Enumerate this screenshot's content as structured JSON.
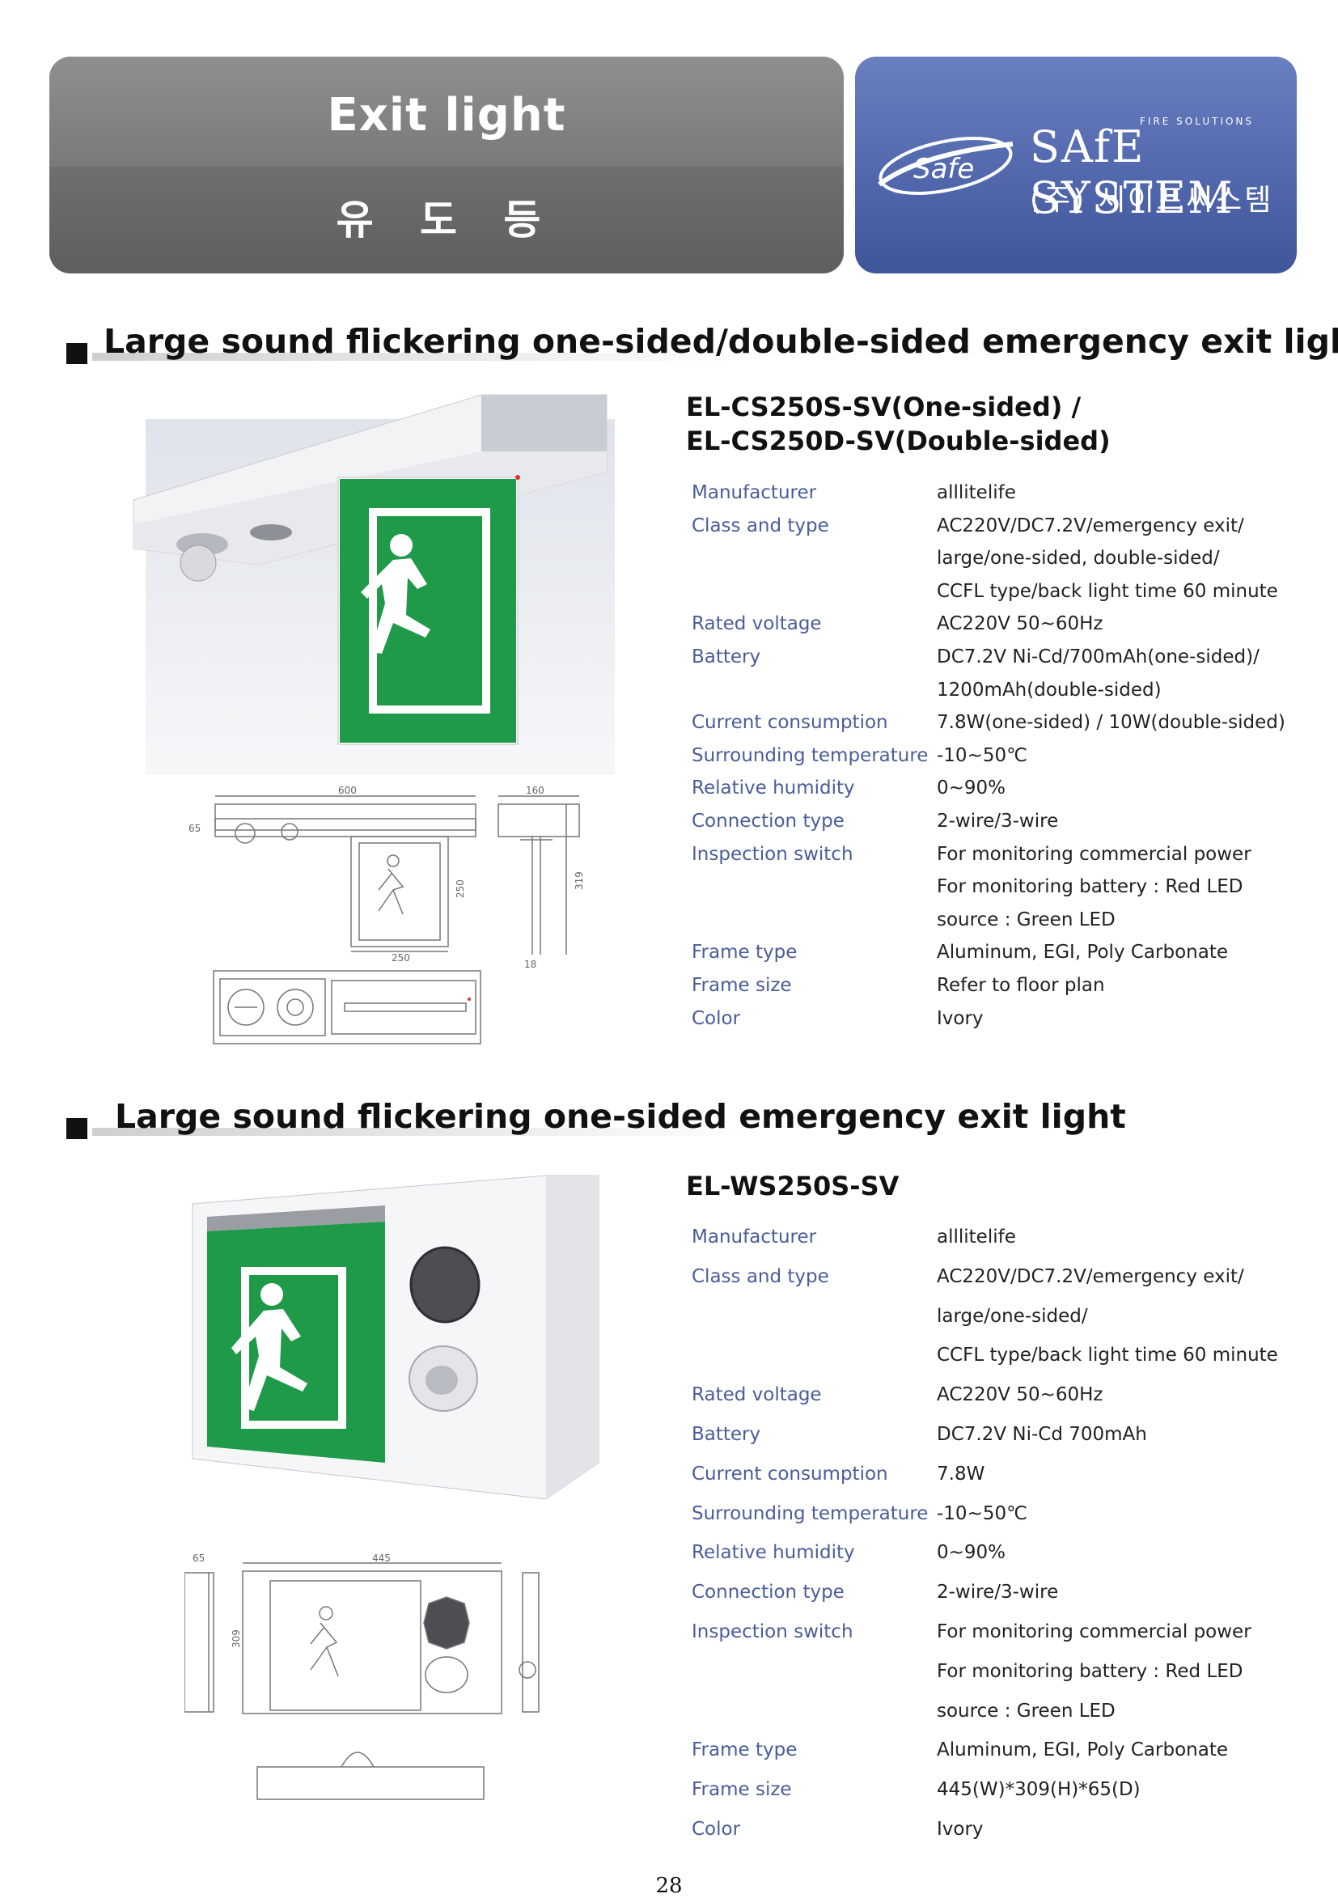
{
  "header": {
    "title": "Exit light",
    "subtitle": "유 도 등",
    "brand_small": "FIRE SOLUTIONS",
    "brand_name": "SAfE SYSTEM",
    "brand_korean": "(주) 세이프씨스템",
    "logo_text": "Safe"
  },
  "section1": {
    "heading": "Large sound flickering one-sided/double-sided emergency exit light",
    "model_line1": "EL-CS250S-SV(One-sided) /",
    "model_line2": "EL-CS250D-SV(Double-sided)",
    "drawing_dims": {
      "d600": "600",
      "d160": "160",
      "d65": "65",
      "d250a": "250",
      "d319": "319",
      "d250b": "250",
      "d18": "18"
    },
    "specs": [
      {
        "label": "Manufacturer",
        "value": "alllitelife"
      },
      {
        "label": "Class and type",
        "value": "AC220V/DC7.2V/emergency exit/"
      },
      {
        "label": "",
        "value": "large/one-sided, double-sided/"
      },
      {
        "label": "",
        "value": "CCFL type/back light time 60 minute"
      },
      {
        "label": "Rated voltage",
        "value": "AC220V 50~60Hz"
      },
      {
        "label": "Battery",
        "value": "DC7.2V Ni-Cd/700mAh(one-sided)/"
      },
      {
        "label": "",
        "value": "1200mAh(double-sided)"
      },
      {
        "label": "Current consumption",
        "value": "7.8W(one-sided) / 10W(double-sided)"
      },
      {
        "label": "Surrounding temperature",
        "value": "-10~50℃"
      },
      {
        "label": "Relative humidity",
        "value": "0~90%"
      },
      {
        "label": "Connection type",
        "value": "2-wire/3-wire"
      },
      {
        "label": "Inspection switch",
        "value": "For monitoring commercial power"
      },
      {
        "label": "",
        "value": "For monitoring battery : Red LED"
      },
      {
        "label": "",
        "value": "source : Green LED"
      },
      {
        "label": "Frame type",
        "value": "Aluminum, EGI, Poly Carbonate"
      },
      {
        "label": "Frame size",
        "value": "Refer to floor plan"
      },
      {
        "label": "Color",
        "value": "Ivory"
      }
    ]
  },
  "section2": {
    "heading": "Large sound flickering one-sided emergency exit light",
    "model": "EL-WS250S-SV",
    "drawing_dims": {
      "d65": "65",
      "d445": "445",
      "d309": "309"
    },
    "specs": [
      {
        "label": "Manufacturer",
        "value": "alllitelife"
      },
      {
        "label": "Class and type",
        "value": "AC220V/DC7.2V/emergency exit/"
      },
      {
        "label": "",
        "value": "large/one-sided/"
      },
      {
        "label": "",
        "value": "CCFL type/back light time 60 minute"
      },
      {
        "label": "Rated voltage",
        "value": "AC220V 50~60Hz"
      },
      {
        "label": "Battery",
        "value": "DC7.2V Ni-Cd 700mAh"
      },
      {
        "label": "Current consumption",
        "value": "7.8W"
      },
      {
        "label": "Surrounding temperature",
        "value": "-10~50℃"
      },
      {
        "label": "Relative humidity",
        "value": "0~90%"
      },
      {
        "label": "Connection type",
        "value": "2-wire/3-wire"
      },
      {
        "label": "Inspection switch",
        "value": "For monitoring commercial power"
      },
      {
        "label": "",
        "value": "For monitoring battery : Red LED"
      },
      {
        "label": "",
        "value": "source : Green LED"
      },
      {
        "label": "Frame type",
        "value": "Aluminum, EGI, Poly Carbonate"
      },
      {
        "label": "Frame size",
        "value": "445(W)*309(H)*65(D)"
      },
      {
        "label": "Color",
        "value": "Ivory"
      }
    ]
  },
  "page_number": "28",
  "colors": {
    "sign_green": "#1f9a48",
    "label_blue": "#4a5d98",
    "header_blue": "#4f66ad",
    "header_gray": "#7b7b7b"
  }
}
